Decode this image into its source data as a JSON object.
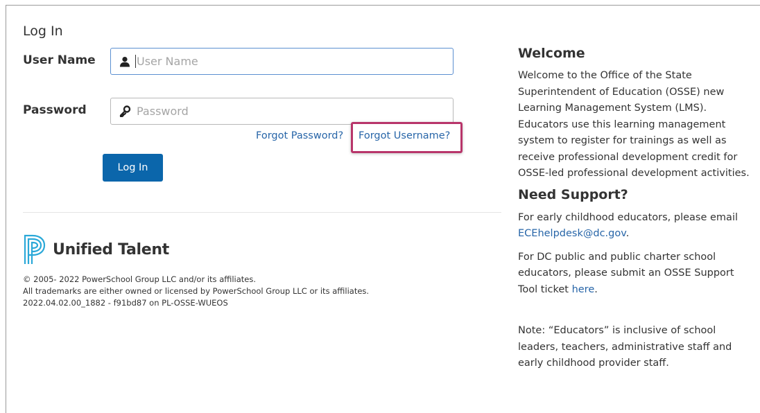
{
  "login": {
    "title": "Log In",
    "username_label": "User Name",
    "username_placeholder": "User Name",
    "password_label": "Password",
    "password_placeholder": "Password",
    "forgot_password": "Forgot Password?",
    "forgot_username": "Forgot Username?",
    "login_button": "Log In"
  },
  "brand": {
    "name": "Unified Talent",
    "logo_color": "#2aa8d8"
  },
  "footer": {
    "line1": "© 2005- 2022 PowerSchool Group LLC and/or its affiliates.",
    "line2": "All trademarks are either owned or licensed by PowerSchool Group LLC or its affiliates.",
    "line3": "2022.04.02.00_1882 - f91bd87 on PL-OSSE-WUEOS"
  },
  "sidebar": {
    "welcome_title": "Welcome",
    "welcome_text": "Welcome to the Office of the State Superintendent of Education (OSSE) new Learning Management System (LMS). Educators use this learning management system to register for trainings as well as receive professional development credit for OSSE-led professional development activities.",
    "support_title": "Need Support?",
    "support_text1": "For early childhood educators, please email",
    "support_email": "ECEhelpdesk@dc.gov",
    "support_text1_end": ".",
    "support_text2": "For DC public and public charter school educators, please submit an OSSE Support Tool ticket",
    "support_link": "here",
    "support_text2_end": ".",
    "note": "Note: “Educators” is inclusive of school leaders, teachers, administrative staff and early childhood provider staff."
  },
  "colors": {
    "accent": "#0b66ab",
    "link": "#2765a8",
    "highlight": "#b8356a"
  }
}
